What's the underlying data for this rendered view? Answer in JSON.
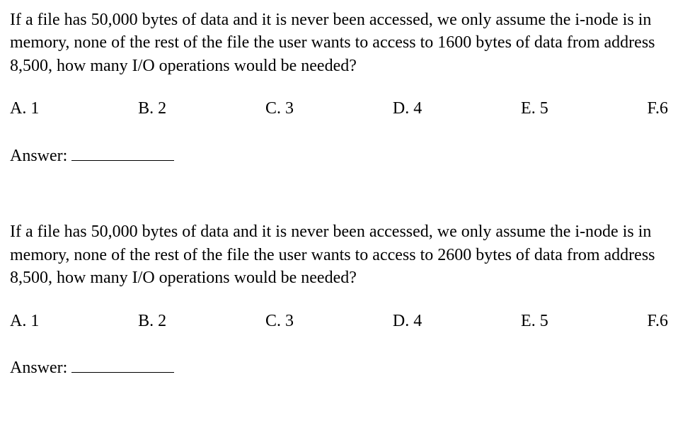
{
  "q1": {
    "text": "If a file has 50,000 bytes of data and it is never been accessed, we only assume the i-node is in memory, none of the rest of the file the user wants to access to 1600 bytes of data from address 8,500, how many I/O operations would be needed?",
    "options": {
      "a": "A. 1",
      "b": "B. 2",
      "c": "C. 3",
      "d": "D. 4",
      "e": "E. 5",
      "f": "F.6"
    },
    "answer_label": "Answer:"
  },
  "q2": {
    "text": "If a file has 50,000 bytes of data and it is never been accessed, we only assume the i-node is in memory, none of the rest of the file the user wants to access to 2600 bytes of data from address 8,500, how many I/O operations would be needed?",
    "options": {
      "a": "A. 1",
      "b": "B. 2",
      "c": "C. 3",
      "d": "D. 4",
      "e": "E. 5",
      "f": "F.6"
    },
    "answer_label": "Answer:"
  }
}
